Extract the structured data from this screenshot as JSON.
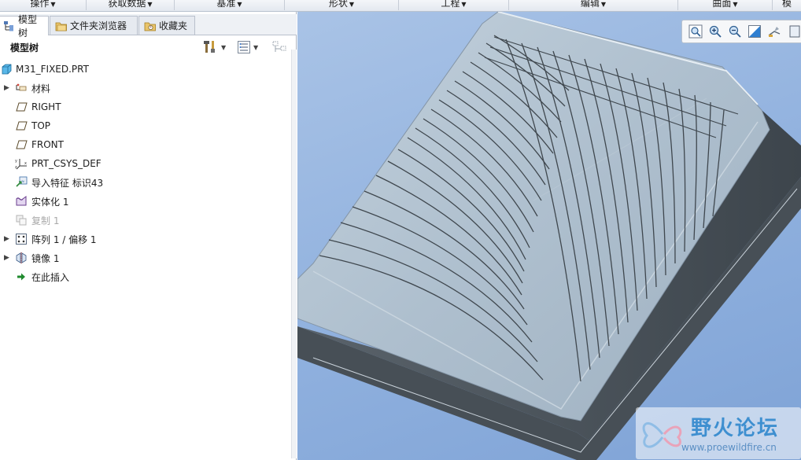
{
  "ribbon": {
    "groups": [
      {
        "label": "操作"
      },
      {
        "label": "获取数据"
      },
      {
        "label": "基准"
      },
      {
        "label": "形状"
      },
      {
        "label": "工程"
      },
      {
        "label": "编辑"
      },
      {
        "label": "曲面"
      },
      {
        "label": "模"
      }
    ]
  },
  "tabs": [
    {
      "label": "模型树"
    },
    {
      "label": "文件夹浏览器"
    },
    {
      "label": "收藏夹"
    }
  ],
  "tree_header": {
    "title": "模型树"
  },
  "tree": {
    "items": [
      {
        "label": "M31_FIXED.PRT",
        "icon": "part-icon"
      },
      {
        "label": "材料",
        "icon": "material-icon",
        "expandable": true
      },
      {
        "label": "RIGHT",
        "icon": "datum-plane-icon"
      },
      {
        "label": "TOP",
        "icon": "datum-plane-icon"
      },
      {
        "label": "FRONT",
        "icon": "datum-plane-icon"
      },
      {
        "label": "PRT_CSYS_DEF",
        "icon": "csys-icon"
      },
      {
        "label": "导入特征 标识43",
        "icon": "import-feature-icon"
      },
      {
        "label": "实体化 1",
        "icon": "solidify-icon"
      },
      {
        "label": "复制 1",
        "icon": "copy-icon",
        "dimmed": true
      },
      {
        "label": "阵列 1 / 偏移 1",
        "icon": "pattern-icon",
        "expandable": true
      },
      {
        "label": "镜像 1",
        "icon": "mirror-icon",
        "expandable": true
      },
      {
        "label": "在此插入",
        "icon": "insert-here-arrow-icon"
      }
    ]
  },
  "viewport_tools": [
    {
      "icon": "zoom-fit-icon"
    },
    {
      "icon": "zoom-in-icon"
    },
    {
      "icon": "zoom-out-icon"
    },
    {
      "icon": "shading-icon"
    },
    {
      "icon": "saved-views-icon"
    },
    {
      "icon": "view-extra-icon"
    }
  ],
  "watermark": {
    "title": "野火论坛",
    "url": "www.proewildfire.cn"
  },
  "colors": {
    "accent": "#3e8fd0",
    "viewport_bg": "#8fb0de",
    "model_face": "#aebfce",
    "model_side": "#4b5258"
  }
}
